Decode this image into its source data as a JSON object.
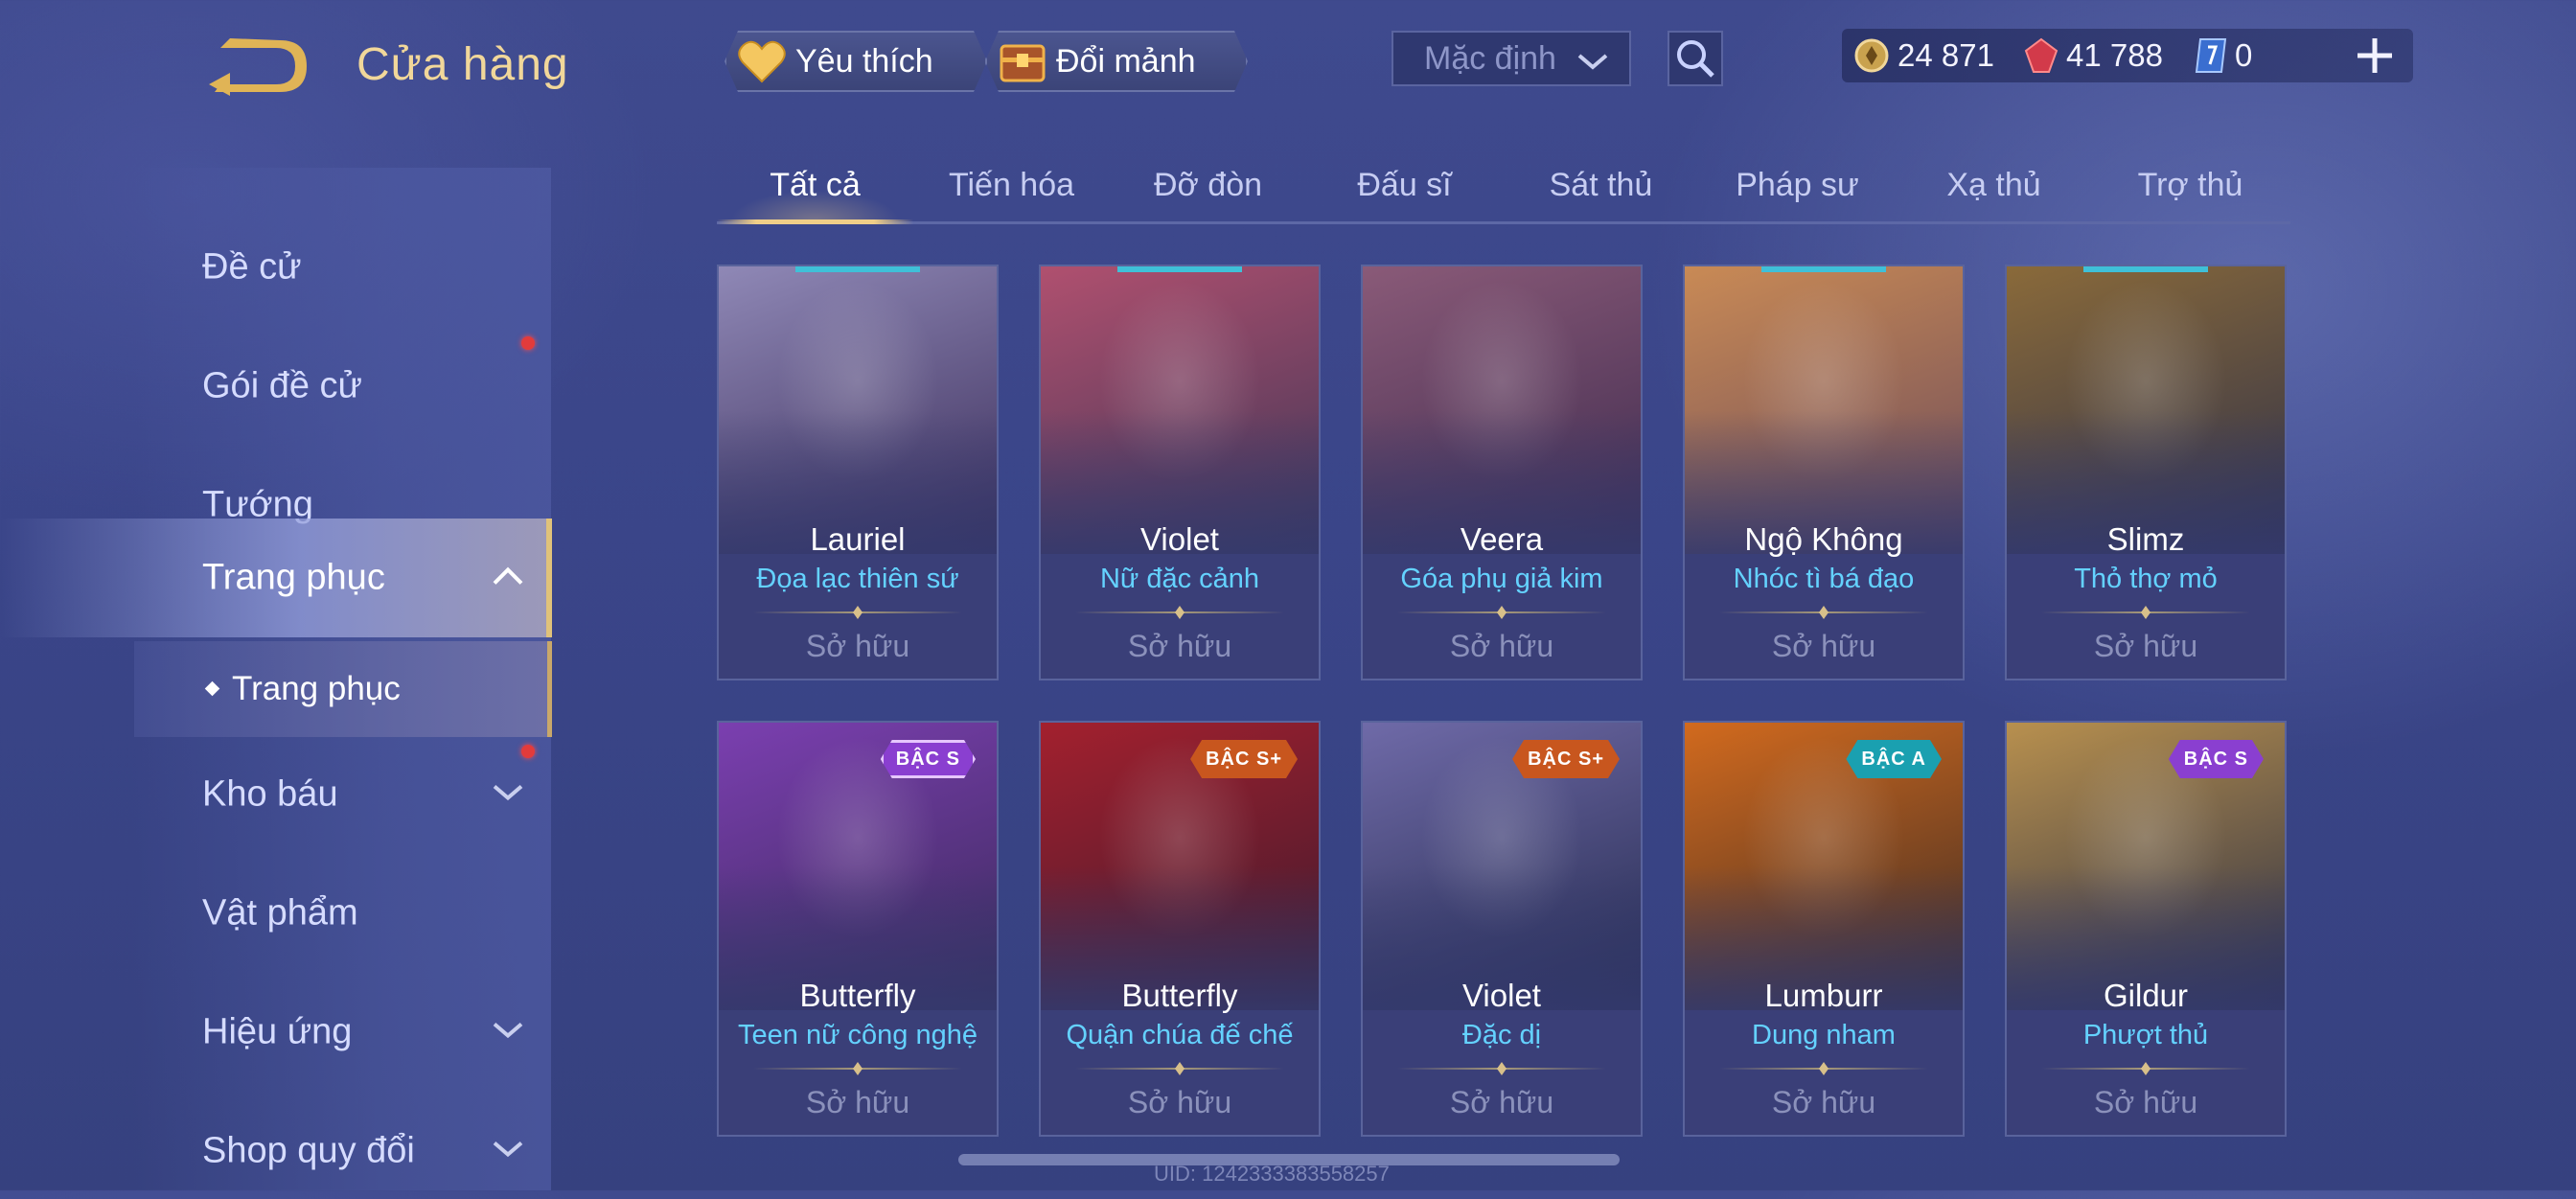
{
  "header": {
    "title": "Cửa hàng",
    "favorite_label": "Yêu thích",
    "shard_label": "Đổi mảnh",
    "sort_value": "Mặc định",
    "currencies": {
      "gold": "24 871",
      "gems": "41 788",
      "tickets": "0"
    }
  },
  "sidebar": {
    "items": [
      {
        "label": "Đề cử"
      },
      {
        "label": "Gói đề cử"
      },
      {
        "label": "Tướng"
      },
      {
        "label": "Trang phục"
      },
      {
        "label": "Kho báu"
      },
      {
        "label": "Vật phẩm"
      },
      {
        "label": "Hiệu ứng"
      },
      {
        "label": "Shop quy đổi"
      }
    ],
    "sub_item": "Trang phục"
  },
  "tabs": [
    "Tất cả",
    "Tiến hóa",
    "Đỡ đòn",
    "Đấu sĩ",
    "Sát thủ",
    "Pháp sư",
    "Xạ thủ",
    "Trợ thủ"
  ],
  "cards": [
    {
      "hero": "Lauriel",
      "skin": "Đọa lạc thiên sứ",
      "status": "Sở hữu",
      "tier": "",
      "palette": [
        "#8f88b6",
        "#3b2d5a"
      ]
    },
    {
      "hero": "Violet",
      "skin": "Nữ đặc cảnh",
      "status": "Sở hữu",
      "tier": "",
      "palette": [
        "#b0506f",
        "#3e3556"
      ]
    },
    {
      "hero": "Veera",
      "skin": "Góa phụ giả kim",
      "status": "Sở hữu",
      "tier": "",
      "palette": [
        "#8a5a78",
        "#3d2a4e"
      ]
    },
    {
      "hero": "Ngộ Không",
      "skin": "Nhóc tì bá đạo",
      "status": "Sở hữu",
      "tier": "",
      "palette": [
        "#c98a55",
        "#6b4a5a"
      ]
    },
    {
      "hero": "Slimz",
      "skin": "Thỏ thợ mỏ",
      "status": "Sở hữu",
      "tier": "",
      "palette": [
        "#8a6a3a",
        "#2e3048"
      ]
    },
    {
      "hero": "Butterfly",
      "skin": "Teen nữ công nghệ",
      "status": "Sở hữu",
      "tier": "BẬC S",
      "palette": [
        "#7b3fb0",
        "#3a2a5a"
      ]
    },
    {
      "hero": "Butterfly",
      "skin": "Quận chúa đế chế",
      "status": "Sở hữu",
      "tier": "BẬC S+",
      "palette": [
        "#a3202e",
        "#3b1a2e"
      ]
    },
    {
      "hero": "Violet",
      "skin": "Đặc dị",
      "status": "Sở hữu",
      "tier": "BẬC S+",
      "palette": [
        "#6f6aa8",
        "#242a4e"
      ]
    },
    {
      "hero": "Lumburr",
      "skin": "Dung nham",
      "status": "Sở hữu",
      "tier": "BẬC A",
      "palette": [
        "#d26a1e",
        "#3a2a24"
      ]
    },
    {
      "hero": "Gildur",
      "skin": "Phượt thủ",
      "status": "Sở hữu",
      "tier": "BẬC S",
      "palette": [
        "#b8904e",
        "#2a2e44"
      ]
    }
  ],
  "footer": {
    "uid": "UID: 1242333383558257"
  },
  "colors": {
    "title_gold": "#f1d79a",
    "skin_blue": "#64d2ff",
    "accent_gold": "#e0c27a",
    "tier_s": "#8a3fd0",
    "tier_splus": "#c8561e",
    "tier_a": "#1aa0b0"
  }
}
